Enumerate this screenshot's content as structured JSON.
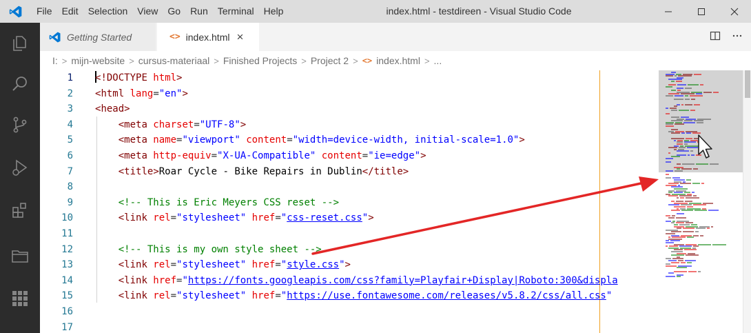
{
  "titlebar": {
    "menu": [
      "File",
      "Edit",
      "Selection",
      "View",
      "Go",
      "Run",
      "Terminal",
      "Help"
    ],
    "window_title": "index.html - testdireen - Visual Studio Code"
  },
  "tabs": [
    {
      "label": "Getting Started",
      "active": false
    },
    {
      "label": "index.html",
      "active": true,
      "close": "×"
    }
  ],
  "breadcrumb": [
    "I:",
    "mijn-website",
    "cursus-materiaal",
    "Finished Projects",
    "Project 2",
    "index.html",
    "..."
  ],
  "editor": {
    "line_numbers": [
      "1",
      "2",
      "3",
      "4",
      "5",
      "6",
      "7",
      "8",
      "9",
      "10",
      "11",
      "12",
      "13",
      "14",
      "15",
      "16",
      "17"
    ],
    "lines": {
      "l1": {
        "t1": "!DOCTYPE",
        "a1": " html",
        "p1": ">"
      },
      "l2": {
        "t1": "html",
        "a1": " lang",
        "s1": "\"en\""
      },
      "l3": {
        "t1": "head"
      },
      "l4": {
        "t1": "meta",
        "a1": " charset",
        "s1": "\"UTF-8\""
      },
      "l5": {
        "t1": "meta",
        "a1": " name",
        "s1": "\"viewport\"",
        "a2": " content",
        "s2": "\"width=device-width, initial-scale=1.0\""
      },
      "l6": {
        "t1": "meta",
        "a1": " http-equiv",
        "s1": "\"X-UA-Compatible\"",
        "a2": " content",
        "s2": "\"ie=edge\""
      },
      "l7": {
        "t1": "title",
        "txt": "Roar Cycle - Bike Repairs in Dublin",
        "t2": "/title"
      },
      "l9": {
        "cm": "<!-- This is Eric Meyers CSS reset -->"
      },
      "l10": {
        "t1": "link",
        "a1": " rel",
        "s1": "\"stylesheet\"",
        "a2": " href",
        "q1": "\"",
        "u1": "css-reset.css",
        "q2": "\""
      },
      "l12": {
        "cm": "<!-- This is my own style sheet -->"
      },
      "l13": {
        "t1": "link",
        "a1": " rel",
        "s1": "\"stylesheet\"",
        "a2": " href",
        "q1": "\"",
        "u1": "style.css",
        "q2": "\""
      },
      "l14": {
        "t1": "link",
        "a1": " href",
        "q1": "\"",
        "u1": "https://fonts.googleapis.com/css?family=Playfair+Display|Roboto:300&displa"
      },
      "l15": {
        "t1": "link",
        "a1": " rel",
        "s1": "\"stylesheet\"",
        "a2": " href",
        "q1": "\"",
        "u1": "https://use.fontawesome.com/releases/v5.8.2/css/all.css",
        "q2": "\""
      }
    }
  },
  "colors": {
    "annotation_arrow": "#e32626",
    "activity_bar": "#2c2c2c",
    "title_bar": "#dddddd",
    "line_number": "#237893",
    "tag": "#800000",
    "attribute": "#e50000",
    "string": "#0000ff",
    "comment": "#008000"
  },
  "icons": {
    "activity": [
      "explorer-icon",
      "search-icon",
      "source-control-icon",
      "run-debug-icon",
      "extensions-icon",
      "folder-icon",
      "apps-grid-icon"
    ],
    "tab_actions": [
      "split-editor-icon",
      "more-actions-icon"
    ]
  }
}
